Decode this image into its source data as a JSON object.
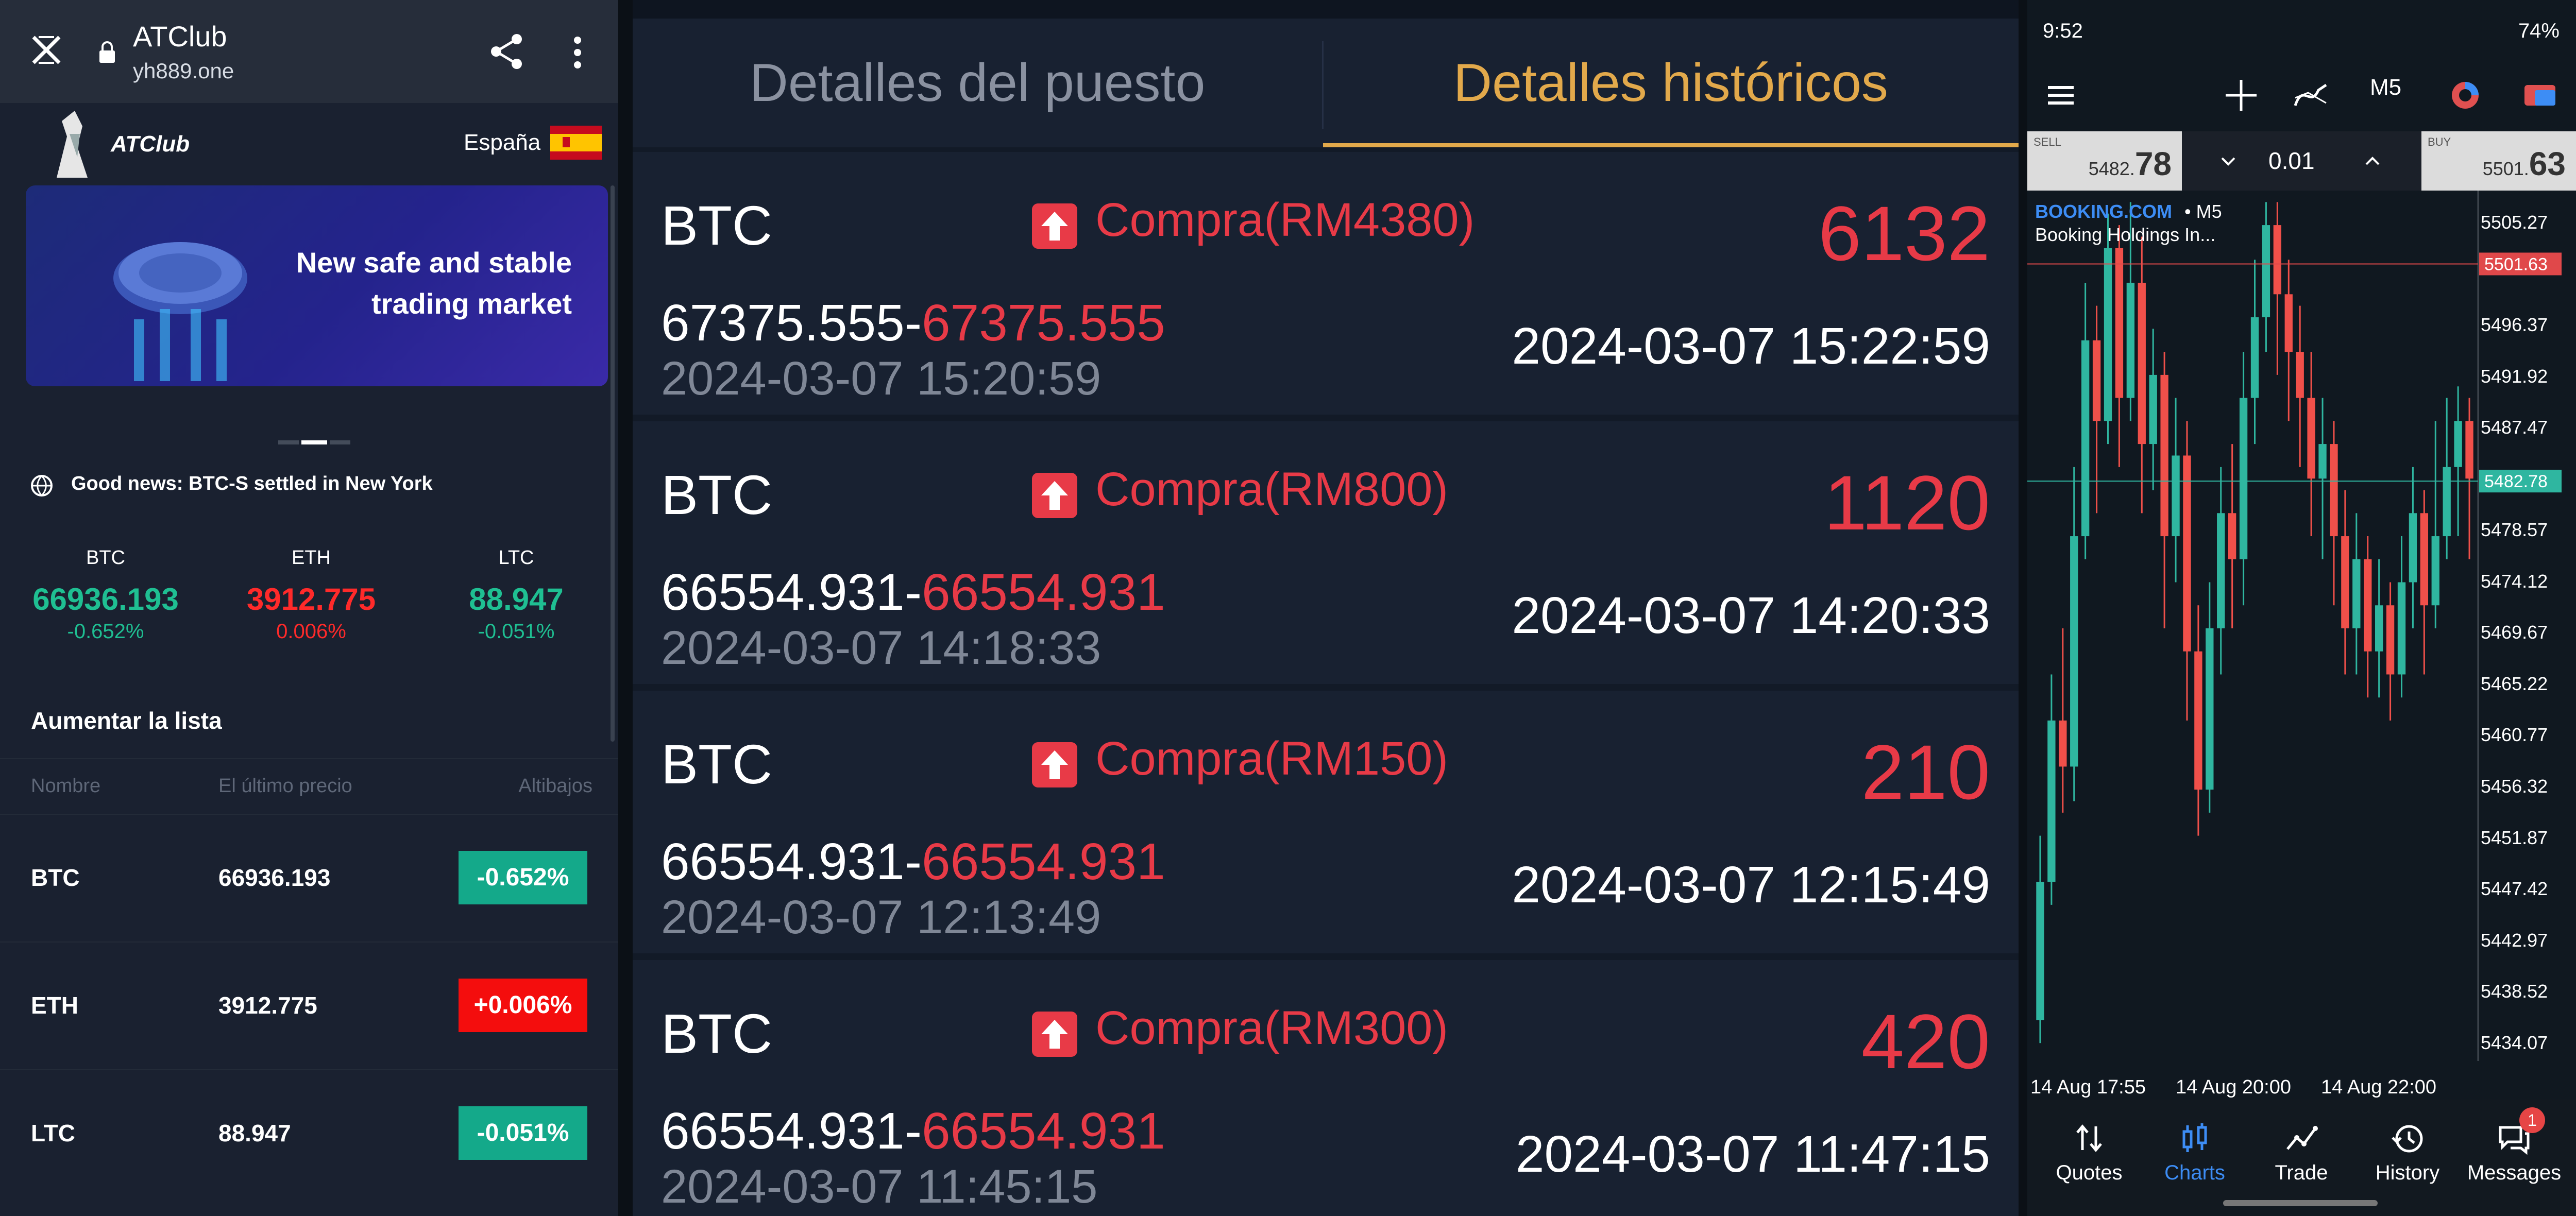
{
  "left": {
    "browser": {
      "title": "ATClub",
      "url": "yh889.one"
    },
    "brand": "ATClub",
    "language": "España",
    "banner": "New safe and stable\ntrading market",
    "news": "Good news: BTC-S settled in New York",
    "tickers": [
      {
        "symbol": "BTC",
        "price": "66936.193",
        "change": "-0.652%",
        "color": "#1fbf92"
      },
      {
        "symbol": "ETH",
        "price": "3912.775",
        "change": "0.006%",
        "color": "#ff2a2a"
      },
      {
        "symbol": "LTC",
        "price": "88.947",
        "change": "-0.051%",
        "color": "#1fbf92"
      }
    ],
    "list_title": "Aumentar la lista",
    "columns": [
      "Nombre",
      "El último precio",
      "Altibajos"
    ],
    "rows": [
      {
        "symbol": "BTC",
        "price": "66936.193",
        "change": "-0.652%",
        "color": "#14a98a"
      },
      {
        "symbol": "ETH",
        "price": "3912.775",
        "change": "+0.006%",
        "color": "#f40d0d"
      },
      {
        "symbol": "LTC",
        "price": "88.947",
        "change": "-0.051%",
        "color": "#14a98a"
      }
    ]
  },
  "middle": {
    "tabs": [
      {
        "label": "Detalles del puesto",
        "active": false
      },
      {
        "label": "Detalles históricos",
        "active": true
      }
    ],
    "orders": [
      {
        "asset": "BTC",
        "side": "Compra(RM4380)",
        "profit": "6132",
        "price_from": "67375.555-",
        "price_to": "67375.555",
        "open_time": "2024-03-07 15:20:59",
        "close_time": "2024-03-07 15:22:59"
      },
      {
        "asset": "BTC",
        "side": "Compra(RM800)",
        "profit": "1120",
        "price_from": "66554.931-",
        "price_to": "66554.931",
        "open_time": "2024-03-07 14:18:33",
        "close_time": "2024-03-07 14:20:33"
      },
      {
        "asset": "BTC",
        "side": "Compra(RM150)",
        "profit": "210",
        "price_from": "66554.931-",
        "price_to": "66554.931",
        "open_time": "2024-03-07 12:13:49",
        "close_time": "2024-03-07 12:15:49"
      },
      {
        "asset": "BTC",
        "side": "Compra(RM300)",
        "profit": "420",
        "price_from": "66554.931-",
        "price_to": "66554.931",
        "open_time": "2024-03-07 11:45:15",
        "close_time": "2024-03-07 11:47:15"
      }
    ],
    "colors": {
      "accent": "#e2a94b",
      "red": "#e83a47"
    }
  },
  "right": {
    "status": {
      "time": "9:52",
      "battery": "74%"
    },
    "timeframe": "M5",
    "trade": {
      "sell_label": "SELL",
      "sell_main": "5482.",
      "sell_big": "78",
      "buy_label": "BUY",
      "buy_main": "5501.",
      "buy_big": "63",
      "lot": "0.01"
    },
    "symbol": "BOOKING.COM",
    "symbol_tf": "• M5",
    "description": "Booking Holdings In...",
    "price_levels": [
      "5505.27",
      "5496.37",
      "5491.92",
      "5487.47",
      "5478.57",
      "5474.12",
      "5469.67",
      "5465.22",
      "5460.77",
      "5456.32",
      "5451.87",
      "5447.42",
      "5442.97",
      "5438.52",
      "5434.07"
    ],
    "ask_line": "5501.63",
    "bid_line": "5482.78",
    "x_labels": [
      "14 Aug 17:55",
      "14 Aug 20:00",
      "14 Aug 22:00"
    ],
    "nav": [
      {
        "label": "Quotes",
        "active": false
      },
      {
        "label": "Charts",
        "active": true
      },
      {
        "label": "Trade",
        "active": false
      },
      {
        "label": "History",
        "active": false
      },
      {
        "label": "Messages",
        "active": false
      }
    ],
    "messages_badge": "1",
    "chart_data": {
      "type": "candlestick",
      "symbol": "BOOKING.COM",
      "timeframe": "M5",
      "ylim": [
        5432,
        5508
      ],
      "x_ticks": [
        "14 Aug 17:55",
        "14 Aug 20:00",
        "14 Aug 22:00"
      ],
      "candles": [
        [
          5436,
          5448,
          5434,
          5452
        ],
        [
          5448,
          5462,
          5446,
          5466
        ],
        [
          5462,
          5458,
          5454,
          5470
        ],
        [
          5458,
          5478,
          5455,
          5484
        ],
        [
          5478,
          5495,
          5476,
          5500
        ],
        [
          5495,
          5488,
          5480,
          5498
        ],
        [
          5488,
          5503,
          5486,
          5506
        ],
        [
          5503,
          5490,
          5484,
          5505
        ],
        [
          5490,
          5500,
          5488,
          5507
        ],
        [
          5500,
          5486,
          5480,
          5504
        ],
        [
          5486,
          5492,
          5482,
          5496
        ],
        [
          5492,
          5478,
          5470,
          5494
        ],
        [
          5478,
          5485,
          5474,
          5490
        ],
        [
          5485,
          5468,
          5462,
          5488
        ],
        [
          5468,
          5456,
          5452,
          5472
        ],
        [
          5456,
          5470,
          5454,
          5474
        ],
        [
          5470,
          5480,
          5466,
          5484
        ],
        [
          5480,
          5476,
          5470,
          5486
        ],
        [
          5476,
          5490,
          5472,
          5494
        ],
        [
          5490,
          5497,
          5486,
          5502
        ],
        [
          5497,
          5505,
          5494,
          5507
        ],
        [
          5505,
          5499,
          5492,
          5507
        ],
        [
          5499,
          5494,
          5488,
          5502
        ],
        [
          5494,
          5490,
          5484,
          5498
        ],
        [
          5490,
          5483,
          5478,
          5494
        ],
        [
          5483,
          5486,
          5476,
          5490
        ],
        [
          5486,
          5478,
          5472,
          5488
        ],
        [
          5478,
          5470,
          5466,
          5482
        ],
        [
          5470,
          5476,
          5466,
          5480
        ],
        [
          5476,
          5468,
          5464,
          5478
        ],
        [
          5468,
          5472,
          5464,
          5476
        ],
        [
          5472,
          5466,
          5462,
          5474
        ],
        [
          5466,
          5474,
          5464,
          5478
        ],
        [
          5474,
          5480,
          5470,
          5484
        ],
        [
          5480,
          5472,
          5466,
          5482
        ],
        [
          5472,
          5478,
          5470,
          5488
        ],
        [
          5478,
          5484,
          5476,
          5490
        ],
        [
          5484,
          5488,
          5478,
          5491
        ],
        [
          5488,
          5483,
          5476,
          5490
        ]
      ]
    }
  }
}
